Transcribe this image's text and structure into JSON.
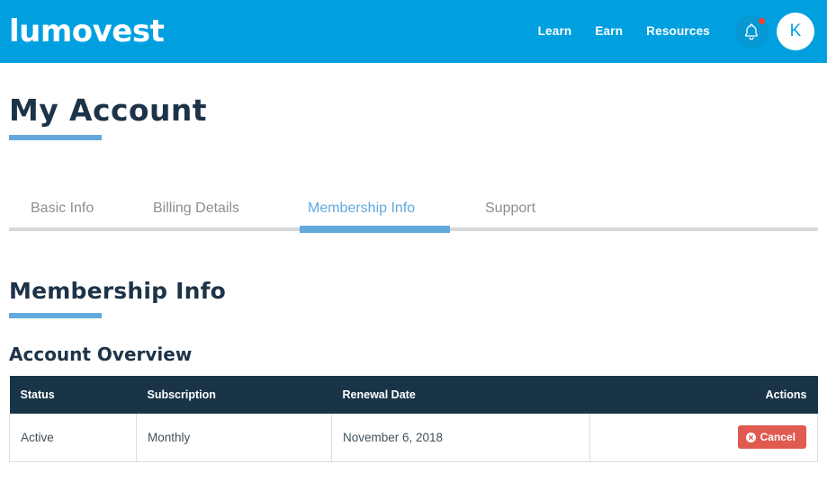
{
  "header": {
    "brand": "lumovest",
    "nav_items": [
      {
        "label": "Learn"
      },
      {
        "label": "Earn"
      },
      {
        "label": "Resources"
      }
    ],
    "notifications_icon": "bell-icon",
    "has_notification_badge": true,
    "avatar_initial": "K",
    "background_color": "#00a0e0"
  },
  "page": {
    "title": "My Account",
    "accent_color": "#63a9dd",
    "heading_color": "#1d3348"
  },
  "tabs": {
    "items": [
      {
        "label": "Basic Info",
        "active": false
      },
      {
        "label": "Billing Details",
        "active": false
      },
      {
        "label": "Membership Info",
        "active": true
      },
      {
        "label": "Support",
        "active": false
      }
    ]
  },
  "main": {
    "section_title": "Membership Info",
    "subsection_title": "Account Overview",
    "table": {
      "columns": [
        "Status",
        "Subscription",
        "Renewal Date",
        "Actions"
      ],
      "header_background": "#1a3447",
      "rows": [
        {
          "status": "Active",
          "subscription": "Monthly",
          "renewal_date": "November 6, 2018",
          "action_label": "Cancel",
          "action_icon": "times-circle-icon",
          "action_color": "#e05a4f"
        }
      ]
    }
  }
}
